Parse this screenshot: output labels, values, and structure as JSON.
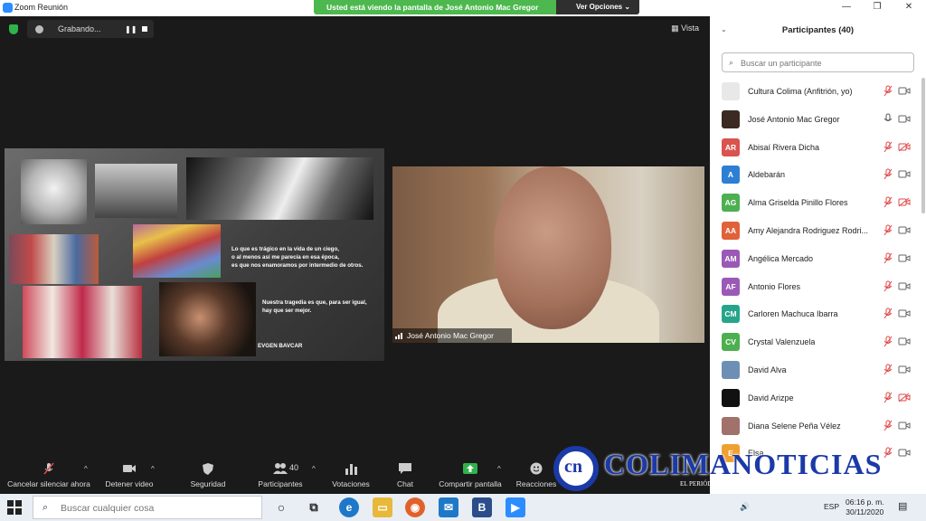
{
  "window": {
    "title": "Zoom Reunión",
    "share_banner": "Usted está viendo la pantalla de José Antonio Mac Gregor",
    "view_options": "Ver Opciones",
    "minimize": "—",
    "restore": "❐",
    "close": "✕"
  },
  "meeting": {
    "recording_label": "Grabando...",
    "pause_glyph": "❚❚",
    "view_label": "Vista",
    "slide": {
      "quote1": [
        "Lo que es trágico en la vida de un ciego,",
        "o al menos así me parecía en esa época,",
        "es que nos enamoramos por intermedio de otros."
      ],
      "quote2": [
        "Nuestra tragedia es que, para ser igual,",
        "hay que ser mejor."
      ],
      "author": "EVGEN BAVCAR"
    },
    "video_name": "José Antonio Mac Gregor"
  },
  "toolbar": {
    "mute": "Cancelar silenciar ahora",
    "stop_video": "Detener video",
    "security": "Seguridad",
    "participants": "Participantes",
    "participants_count": "40",
    "polls": "Votaciones",
    "chat": "Chat",
    "share": "Compartir pantalla",
    "reactions": "Reacciones",
    "caret": "^"
  },
  "panel": {
    "title": "Participantes (40)",
    "collapse": "⌄",
    "search_placeholder": "Buscar un participante",
    "participants": [
      {
        "initials": "",
        "name": "Cultura Colima (Anfitrión, yo)",
        "color": "#e8e8e8",
        "mic": "muted",
        "cam": "on"
      },
      {
        "initials": "",
        "name": "José Antonio Mac Gregor",
        "color": "#3a2a22",
        "mic": "on",
        "cam": "on"
      },
      {
        "initials": "AR",
        "name": "Abisaí Rivera Dicha",
        "color": "#d9534f",
        "mic": "muted",
        "cam": "off"
      },
      {
        "initials": "A",
        "name": "Aldebarán",
        "color": "#2d7fd3",
        "mic": "muted",
        "cam": "on"
      },
      {
        "initials": "AG",
        "name": "Alma Griselda Pinillo Flores",
        "color": "#4caf50",
        "mic": "muted",
        "cam": "off"
      },
      {
        "initials": "AA",
        "name": "Amy Alejandra Rodriguez Rodri...",
        "color": "#e0623a",
        "mic": "muted",
        "cam": "on"
      },
      {
        "initials": "AM",
        "name": "Angélica Mercado",
        "color": "#9b59b6",
        "mic": "muted",
        "cam": "on"
      },
      {
        "initials": "AF",
        "name": "Antonio Flores",
        "color": "#9b59b6",
        "mic": "muted",
        "cam": "on"
      },
      {
        "initials": "CM",
        "name": "Carloren Machuca Ibarra",
        "color": "#27a58a",
        "mic": "muted",
        "cam": "on"
      },
      {
        "initials": "CV",
        "name": "Crystal Valenzuela",
        "color": "#4caf50",
        "mic": "muted",
        "cam": "on"
      },
      {
        "initials": "",
        "name": "David Alva",
        "color": "#6d8fb5",
        "mic": "muted",
        "cam": "on"
      },
      {
        "initials": "",
        "name": "David Arizpe",
        "color": "#111111",
        "mic": "muted",
        "cam": "off"
      },
      {
        "initials": "",
        "name": "Diana Selene Peña Vélez",
        "color": "#a0726a",
        "mic": "muted",
        "cam": "on"
      },
      {
        "initials": "E",
        "name": "Elsa",
        "color": "#f0a030",
        "mic": "muted",
        "cam": "on"
      }
    ]
  },
  "watermark": {
    "logo_text": "cn",
    "brand": "COLIMANOTICIAS",
    "tagline": "EL PERIÓDICO POR INTERNET"
  },
  "taskbar": {
    "search_placeholder": "Buscar cualquier cosa",
    "language": "ESP",
    "time": "06:16 p. m.",
    "date": "30/11/2020"
  }
}
